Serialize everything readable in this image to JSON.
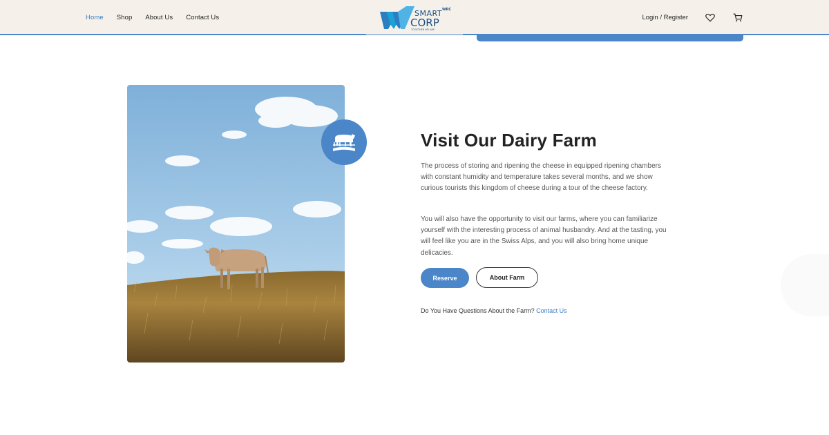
{
  "header": {
    "nav": [
      {
        "label": "Home",
        "active": true
      },
      {
        "label": "Shop",
        "active": false
      },
      {
        "label": "About Us",
        "active": false
      },
      {
        "label": "Contact Us",
        "active": false
      }
    ],
    "logo": {
      "line1": "SMART",
      "line2": "CORP",
      "suffix": "WRC",
      "tagline": "TOGETHER WE ARE",
      "icon": "wc-logo-mark"
    },
    "login_label": "Login / Register",
    "wishlist_icon": "heart-icon",
    "cart_icon": "cart-icon"
  },
  "hero": {
    "image": "cow-on-hillside",
    "badge_icon": "cow-farm-icon",
    "title": "Visit Our Dairy Farm",
    "paragraph1": "The process of storing and ripening the cheese in equipped ripening chambers with constant humidity and temperature takes several months, and we show curious tourists this kingdom of cheese during a tour of the cheese factory.",
    "paragraph2": "You will also have the opportunity to visit our farms, where you can familiarize yourself with the interesting process of animal husbandry. And at the tasting, you will feel like you are in the Swiss Alps, and you will also bring home unique delicacies.",
    "reserve_label": "Reserve",
    "about_label": "About Farm",
    "question_text": "Do You Have Questions About the Farm?",
    "contact_link": "Contact Us"
  },
  "colors": {
    "accent": "#4a86c8",
    "header_bg": "#f5f1ea"
  }
}
